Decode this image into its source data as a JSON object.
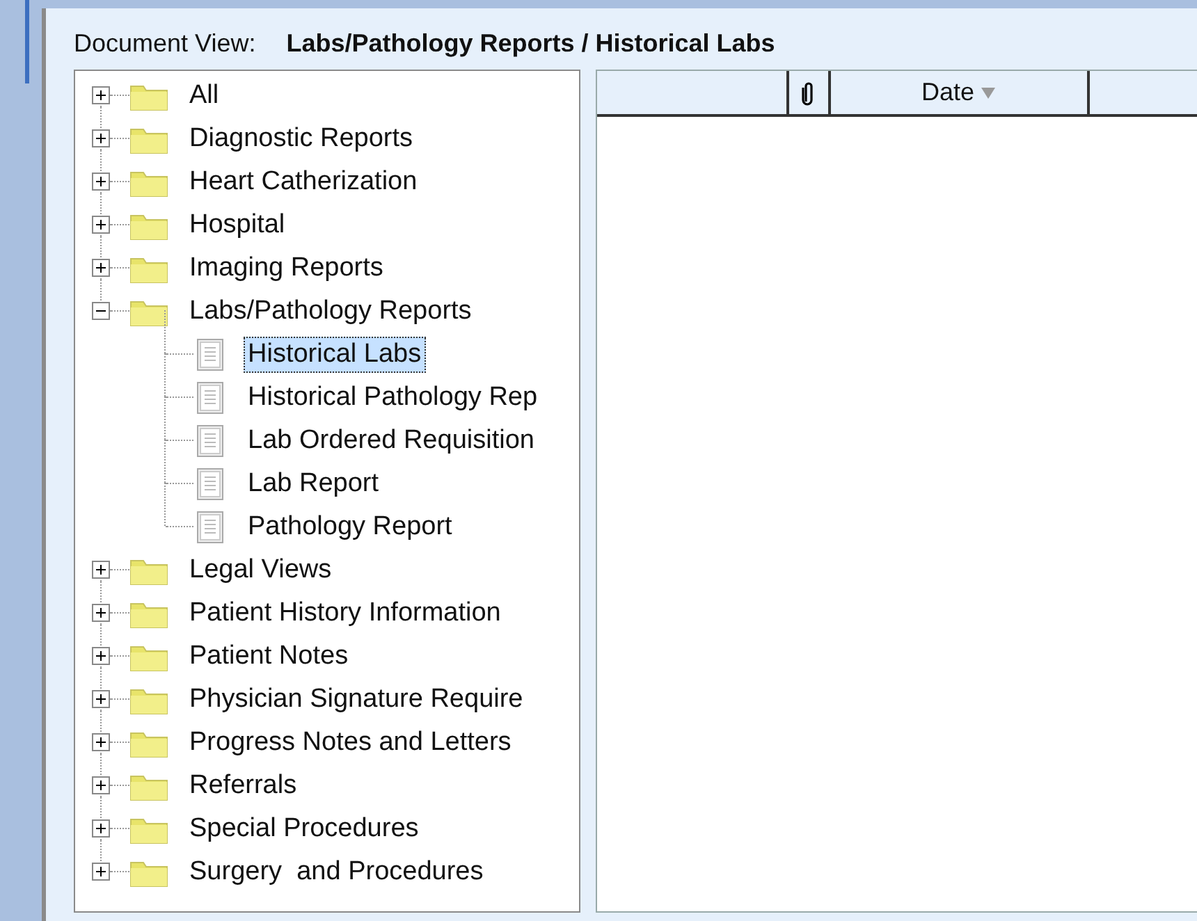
{
  "header": {
    "label": "Document View:",
    "path": "Labs/Pathology Reports / Historical Labs"
  },
  "tree": [
    {
      "label": "All",
      "expanded": false,
      "selected": false
    },
    {
      "label": "Diagnostic Reports",
      "expanded": false,
      "selected": false
    },
    {
      "label": "Heart Catherization",
      "expanded": false,
      "selected": false
    },
    {
      "label": "Hospital",
      "expanded": false,
      "selected": false
    },
    {
      "label": "Imaging Reports",
      "expanded": false,
      "selected": false
    },
    {
      "label": "Labs/Pathology Reports",
      "expanded": true,
      "selected": false,
      "children": [
        {
          "label": "Historical Labs",
          "selected": true
        },
        {
          "label": "Historical Pathology Rep",
          "selected": false
        },
        {
          "label": "Lab Ordered Requisition",
          "selected": false
        },
        {
          "label": "Lab Report",
          "selected": false
        },
        {
          "label": "Pathology Report",
          "selected": false
        }
      ]
    },
    {
      "label": "Legal Views",
      "expanded": false,
      "selected": false
    },
    {
      "label": "Patient History Information",
      "expanded": false,
      "selected": false
    },
    {
      "label": "Patient Notes",
      "expanded": false,
      "selected": false
    },
    {
      "label": "Physician Signature Require",
      "expanded": false,
      "selected": false
    },
    {
      "label": "Progress Notes and Letters",
      "expanded": false,
      "selected": false
    },
    {
      "label": "Referrals",
      "expanded": false,
      "selected": false
    },
    {
      "label": "Special Procedures",
      "expanded": false,
      "selected": false
    },
    {
      "label": "Surgery  and Procedures",
      "expanded": false,
      "selected": false
    }
  ],
  "list": {
    "columns": [
      {
        "kind": "blank"
      },
      {
        "kind": "attachment"
      },
      {
        "kind": "text",
        "label": "Date",
        "sorted": true
      },
      {
        "kind": "blank"
      }
    ]
  }
}
